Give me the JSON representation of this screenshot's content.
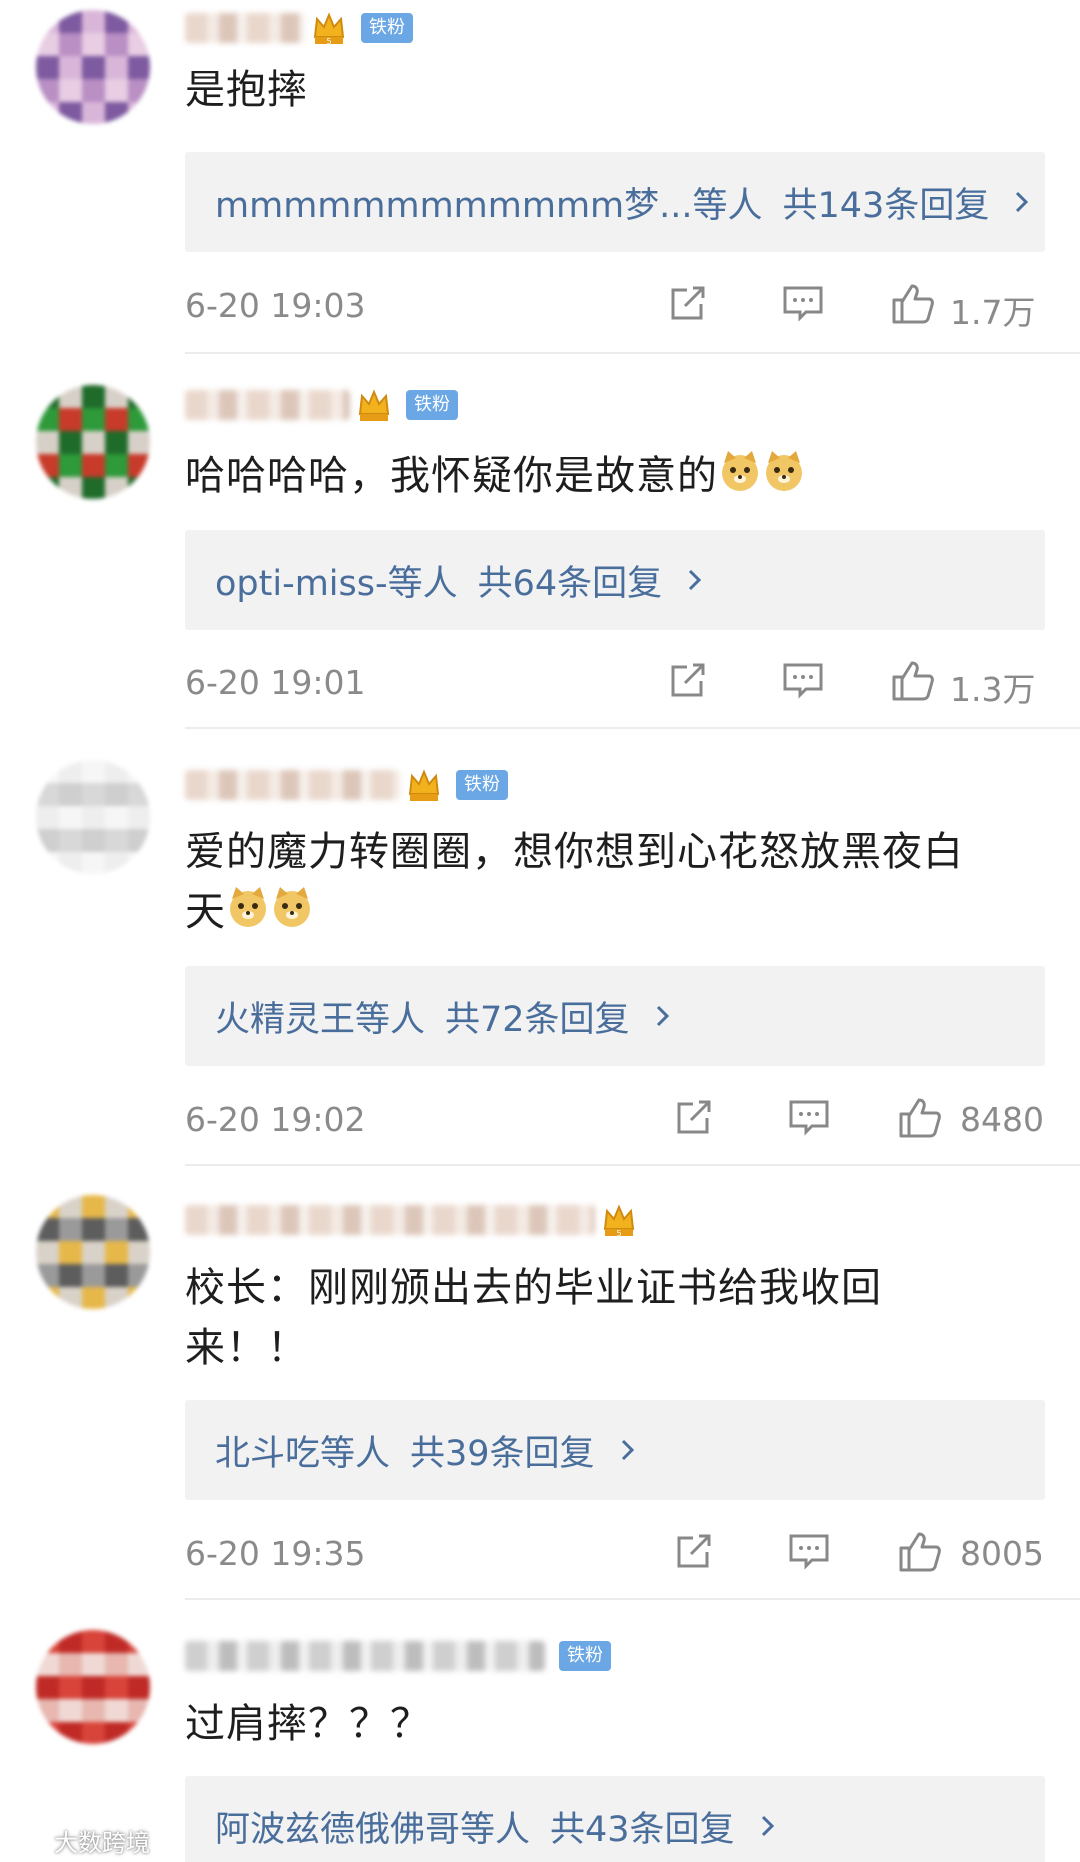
{
  "comments": [
    {
      "badge": "铁粉",
      "text_lines": [
        "是抱摔"
      ],
      "reply_who": "mmmmmmmmmmmm梦...等人",
      "reply_count": "共143条回复",
      "time": "6-20 19:03",
      "likes": "1.7万",
      "avatar_colors": [
        "#d9b6d9",
        "#b98fc4",
        "#7e5aa0",
        "#e8cde3"
      ]
    },
    {
      "badge": "铁粉",
      "text_lines": [
        "哈哈哈哈，我怀疑你是故意的"
      ],
      "emoji_count": 2,
      "reply_who": "opti-miss-等人",
      "reply_count": "共64条回复",
      "time": "6-20 19:01",
      "likes": "1.3万",
      "avatar_colors": [
        "#2e9a3a",
        "#1f6b2a",
        "#c83a2a",
        "#d7d0c8"
      ]
    },
    {
      "badge": "铁粉",
      "text_lines": [
        "爱的魔力转圈圈，想你想到心花怒放黑夜白",
        "天"
      ],
      "emoji_count": 2,
      "reply_who": "火精灵王等人",
      "reply_count": "共72条回复",
      "time": "6-20 19:02",
      "likes": "8480",
      "avatar_colors": [
        "#eeeeee",
        "#d8d8d8",
        "#f6f6f6",
        "#cfcfcf"
      ]
    },
    {
      "text_lines": [
        "校长：刚刚颁出去的毕业证书给我收回",
        "来！！"
      ],
      "reply_who": "北斗吃等人",
      "reply_count": "共39条回复",
      "time": "6-20 19:35",
      "likes": "8005",
      "avatar_colors": [
        "#9a9a9a",
        "#d9d2c8",
        "#5d5d5d",
        "#e6b84a"
      ]
    },
    {
      "badge": "铁粉",
      "text_lines": [
        "过肩摔？？？"
      ],
      "reply_who": "阿波兹德俄佛哥等人",
      "reply_count": "共43条回复",
      "avatar_colors": [
        "#d8443a",
        "#e7b7b0",
        "#c02a26",
        "#f0d9d4"
      ]
    }
  ],
  "watermark": "大数跨境",
  "colors": {
    "link": "#4a6e9c",
    "badge": "#6aa7e4",
    "meta": "#8a8a8a",
    "reply_bg": "#f2f2f2"
  },
  "icons": [
    "share-icon",
    "comment-icon",
    "like-icon",
    "chevron-right-icon",
    "crown-icon",
    "doge-emoji-icon"
  ]
}
